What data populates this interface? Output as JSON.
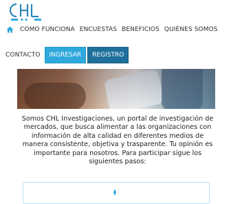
{
  "brand": {
    "logo_text": "CHL",
    "primary_color": "#2fa9dc",
    "dark_color": "#1e6f9b"
  },
  "nav": {
    "home_icon": "home-icon",
    "items": [
      {
        "label": "COMO FUNCIONA"
      },
      {
        "label": "ENCUESTAS"
      },
      {
        "label": "BENEFICIOS"
      },
      {
        "label": "QUIÉNES SOMOS"
      },
      {
        "label": "CONTACTO"
      }
    ],
    "login_label": "INGRESAR",
    "register_label": "REGISTRO"
  },
  "intro": {
    "text": "Somos CHL Investigaciones, un portal de investigación de mercados, que busca alimentar a las organizaciones con información de alta calidad en diferentes medios de manera consistente, objetiva y trasparente. Tu opinión es importante para nosotros. Para participar sigue los siguientes pasos:"
  }
}
